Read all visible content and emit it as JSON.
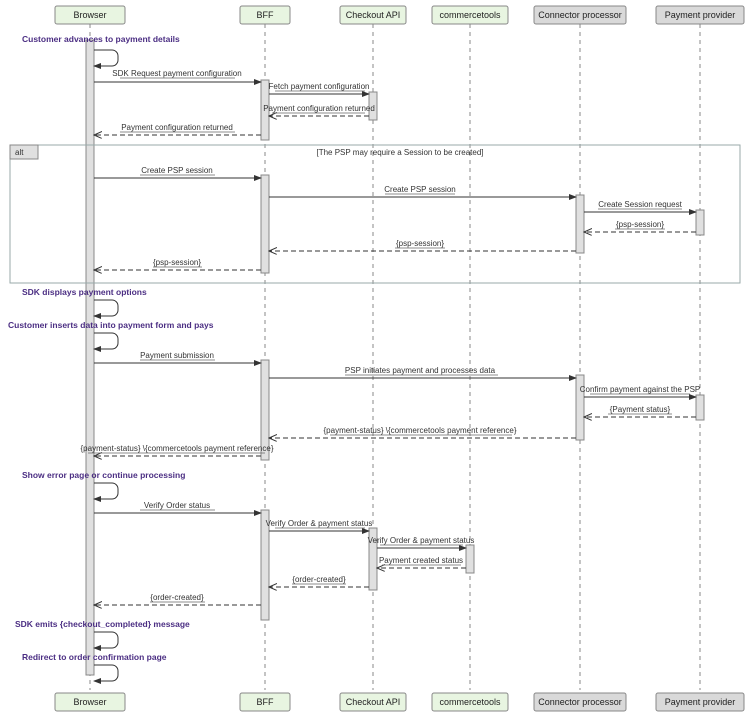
{
  "participants": [
    "Browser",
    "BFF",
    "Checkout API",
    "commercetools",
    "Connector processor",
    "Payment provider"
  ],
  "self_actions": {
    "a1": "Customer advances to payment details",
    "a2": "SDK displays payment options",
    "a3": "Customer inserts data into payment form and pays",
    "a4": "Show error page or continue processing",
    "a5": "SDK emits {checkout_completed} message",
    "a6": "Redirect to order confirmation page"
  },
  "messages": {
    "m1": "SDK Request payment configuration",
    "m2": "Fetch payment configuration",
    "m3": "Payment configuration returned",
    "m4": "Payment configuration returned",
    "alt_label": "alt",
    "alt_cond": "[The PSP may require a Session to be created]",
    "m5": "Create PSP session",
    "m6": "Create PSP session",
    "m7": "Create Session request",
    "m8": "{psp-session}",
    "m9": "{psp-session}",
    "m10": "{psp-session}",
    "m11": "Payment submission",
    "m12": "PSP initiates payment and processes data",
    "m13": "Confirm payment against the PSP",
    "m14": "{Payment status}",
    "m15": "{payment-status} \\{commercetools payment reference}",
    "m16": "{payment-status} \\{commercetools payment reference}",
    "m17": "Verify Order status",
    "m18": "Verify Order & payment status",
    "m19": "Verify Order & payment status",
    "m20": "Payment created status",
    "m21": "{order-created}",
    "m22": "{order-created}"
  }
}
